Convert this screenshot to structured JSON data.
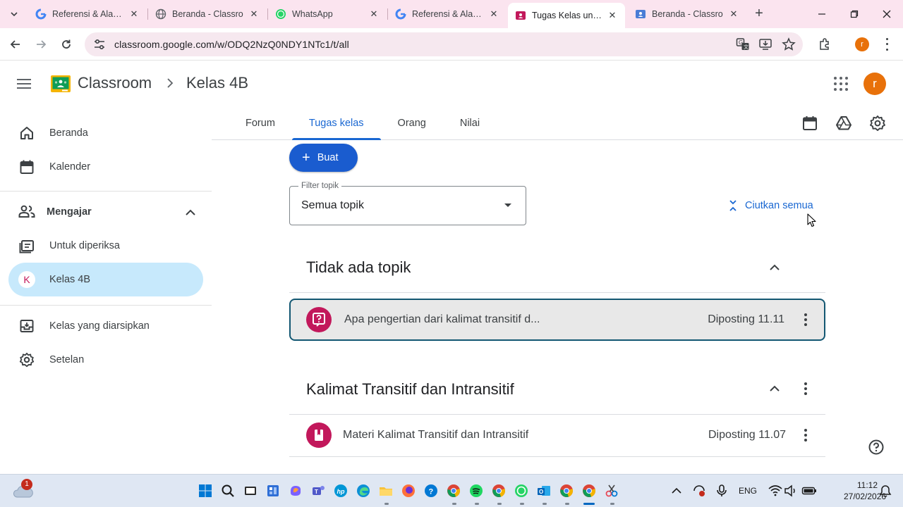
{
  "browser": {
    "tabs": [
      {
        "title": "Referensi & Alat Pe",
        "favicon": "google-icon"
      },
      {
        "title": "Beranda - Classro",
        "favicon": "globe-icon"
      },
      {
        "title": "WhatsApp",
        "favicon": "whatsapp-icon"
      },
      {
        "title": "Referensi & Alat Pe",
        "favicon": "google-icon"
      },
      {
        "title": "Tugas Kelas untuk",
        "favicon": "classroom-icon",
        "active": true
      },
      {
        "title": "Beranda - Classro",
        "favicon": "classroom-icon"
      }
    ],
    "url": "classroom.google.com/w/ODQ2NzQ0NDY1NTc1/t/all",
    "profile_initial": "r"
  },
  "app": {
    "name": "Classroom",
    "class_name": "Kelas 4B",
    "avatar_initial": "r"
  },
  "sidebar": {
    "items": [
      {
        "label": "Beranda",
        "icon": "home-icon"
      },
      {
        "label": "Kalender",
        "icon": "calendar-icon"
      }
    ],
    "teaching": {
      "label": "Mengajar",
      "items": [
        {
          "label": "Untuk diperiksa",
          "icon": "review-icon"
        },
        {
          "label": "Kelas 4B",
          "badge": "K",
          "selected": true
        }
      ]
    },
    "bottom_items": [
      {
        "label": "Kelas yang diarsipkan",
        "icon": "archive-icon"
      },
      {
        "label": "Setelan",
        "icon": "settings-icon"
      }
    ]
  },
  "tabs": [
    "Forum",
    "Tugas kelas",
    "Orang",
    "Nilai"
  ],
  "active_tab": "Tugas kelas",
  "create_button": "Buat",
  "filter": {
    "label": "Filter topik",
    "value": "Semua topik"
  },
  "collapse_all": "Ciutkan semua",
  "topics": [
    {
      "title": "Tidak ada topik",
      "items": [
        {
          "title": "Apa pengertian dari kalimat transitif d...",
          "posted": "Diposting 11.11",
          "type": "question"
        }
      ]
    },
    {
      "title": "Kalimat Transitif dan Intransitif",
      "items": [
        {
          "title": "Materi Kalimat Transitif dan Intransitif",
          "posted": "Diposting 11.07",
          "type": "material"
        }
      ]
    }
  ],
  "taskbar": {
    "weather_badge": "1",
    "language": "ENG",
    "time": "11:12",
    "date": "27/02/2026"
  },
  "colors": {
    "accent": "#1967d2",
    "primary_button": "#1a5ccf",
    "assignment_icon": "#c2185b",
    "selected_nav": "#c7e9fc",
    "tabstrip": "#fbe4ef"
  }
}
